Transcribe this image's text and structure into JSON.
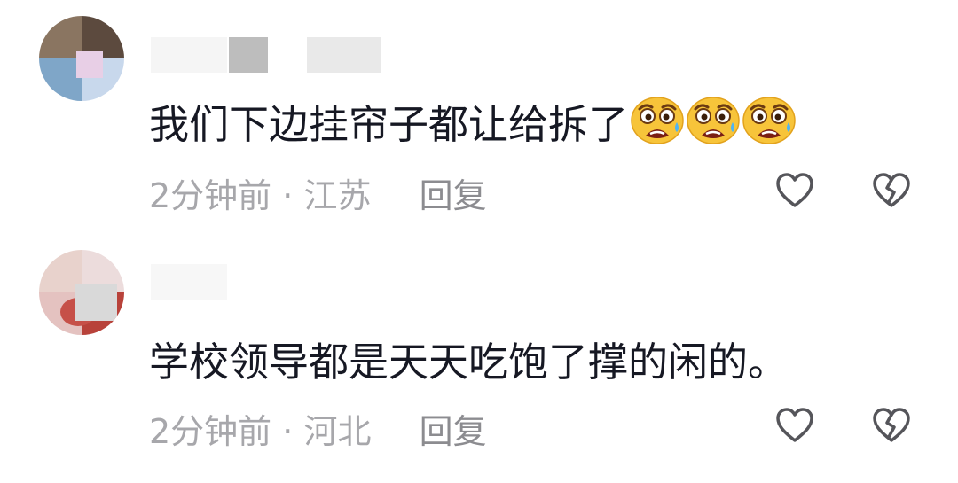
{
  "comments": [
    {
      "text": "我们下边挂帘子都让给拆了",
      "emojis": [
        "crying-shocked-emoji",
        "crying-shocked-emoji",
        "crying-shocked-emoji"
      ],
      "time": "2分钟前",
      "separator": "·",
      "location": "江苏",
      "reply_label": "回复"
    },
    {
      "text": "学校领导都是天天吃饱了撑的闲的。",
      "emojis": [],
      "time": "2分钟前",
      "separator": "·",
      "location": "河北",
      "reply_label": "回复"
    }
  ],
  "icons": {
    "like": "heart-outline-icon",
    "dislike": "broken-heart-icon"
  },
  "colors": {
    "text": "#161823",
    "meta": "#a7a7ab",
    "icon": "#55555a"
  }
}
